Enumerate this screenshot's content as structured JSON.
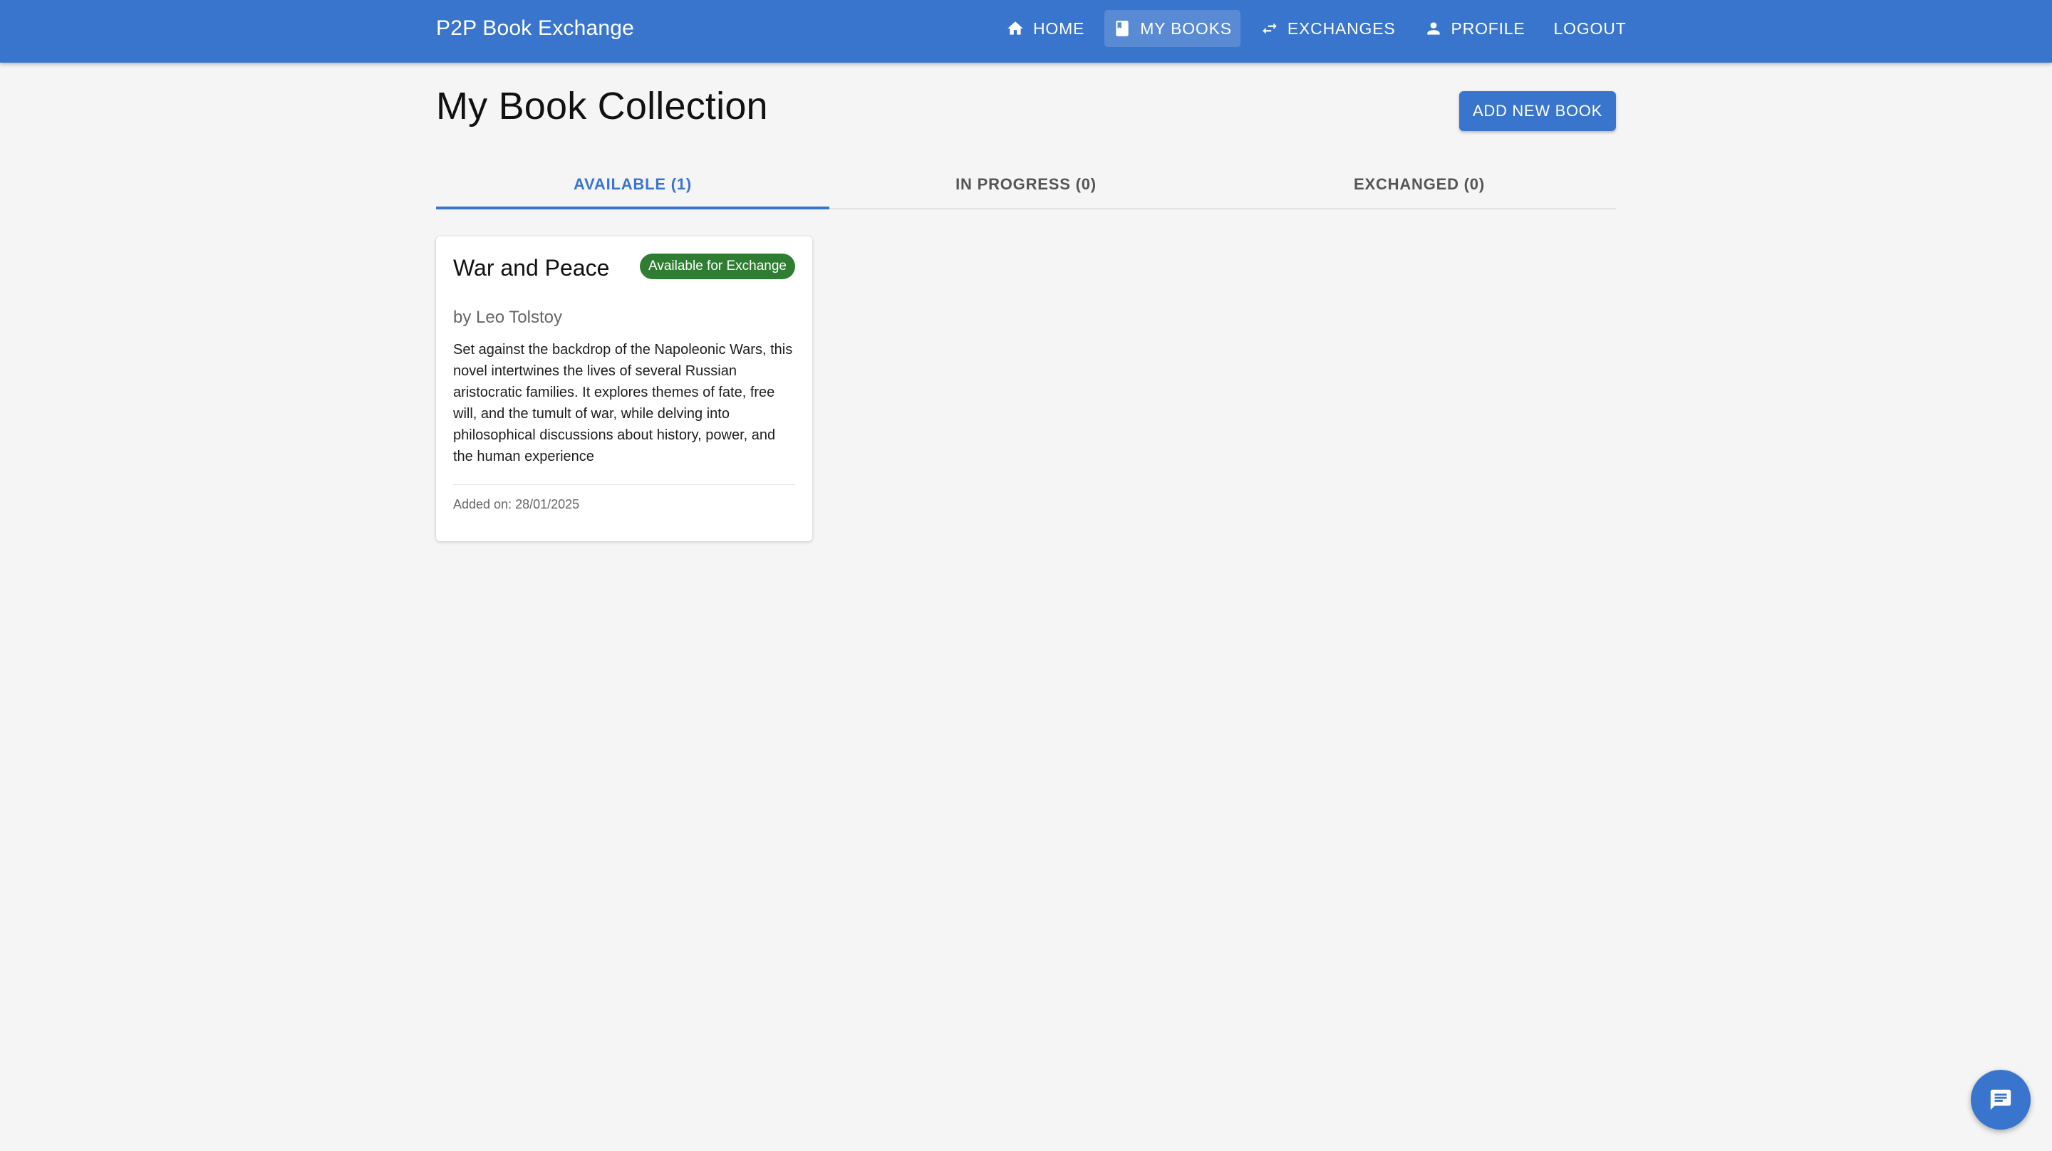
{
  "app": {
    "title": "P2P Book Exchange",
    "accent_color": "#3a75cd"
  },
  "nav": {
    "items": [
      {
        "label": "HOME",
        "icon": "home-icon",
        "active": false
      },
      {
        "label": "MY BOOKS",
        "icon": "book-icon",
        "active": true
      },
      {
        "label": "EXCHANGES",
        "icon": "swap-arrows-icon",
        "active": false
      },
      {
        "label": "PROFILE",
        "icon": "person-icon",
        "active": false
      },
      {
        "label": "LOGOUT",
        "icon": null,
        "active": false
      }
    ]
  },
  "page": {
    "title": "My Book Collection",
    "add_button_label": "ADD NEW BOOK"
  },
  "tabs": [
    {
      "label": "AVAILABLE (1)",
      "active": true
    },
    {
      "label": "IN PROGRESS (0)",
      "active": false
    },
    {
      "label": "EXCHANGED (0)",
      "active": false
    }
  ],
  "books": [
    {
      "title": "War and Peace",
      "status": "Available for Exchange",
      "status_color": "#2f7d32",
      "author": "by Leo Tolstoy",
      "description": "Set against the backdrop of the Napoleonic Wars, this novel intertwines the lives of several Russian aristocratic families. It explores themes of fate, free will, and the tumult of war, while delving into philosophical discussions about history, power, and the human experience",
      "added_on": "Added on: 28/01/2025"
    }
  ],
  "fab": {
    "icon": "chat-icon"
  }
}
